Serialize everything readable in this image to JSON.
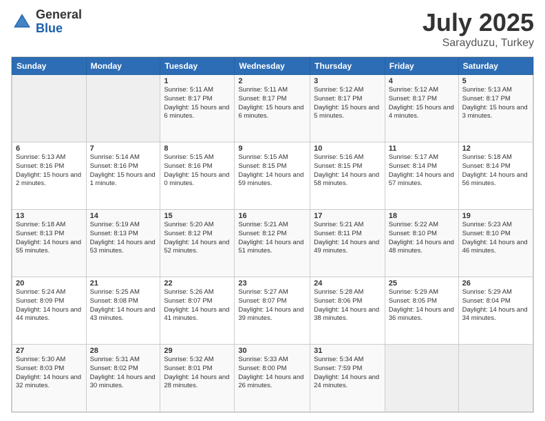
{
  "header": {
    "logo_general": "General",
    "logo_blue": "Blue",
    "main_title": "July 2025",
    "subtitle": "Sarayduzu, Turkey"
  },
  "calendar": {
    "days_of_week": [
      "Sunday",
      "Monday",
      "Tuesday",
      "Wednesday",
      "Thursday",
      "Friday",
      "Saturday"
    ],
    "weeks": [
      [
        {
          "day": "",
          "empty": true
        },
        {
          "day": "",
          "empty": true
        },
        {
          "day": "1",
          "sunrise": "Sunrise: 5:11 AM",
          "sunset": "Sunset: 8:17 PM",
          "daylight": "Daylight: 15 hours and 6 minutes."
        },
        {
          "day": "2",
          "sunrise": "Sunrise: 5:11 AM",
          "sunset": "Sunset: 8:17 PM",
          "daylight": "Daylight: 15 hours and 6 minutes."
        },
        {
          "day": "3",
          "sunrise": "Sunrise: 5:12 AM",
          "sunset": "Sunset: 8:17 PM",
          "daylight": "Daylight: 15 hours and 5 minutes."
        },
        {
          "day": "4",
          "sunrise": "Sunrise: 5:12 AM",
          "sunset": "Sunset: 8:17 PM",
          "daylight": "Daylight: 15 hours and 4 minutes."
        },
        {
          "day": "5",
          "sunrise": "Sunrise: 5:13 AM",
          "sunset": "Sunset: 8:17 PM",
          "daylight": "Daylight: 15 hours and 3 minutes."
        }
      ],
      [
        {
          "day": "6",
          "sunrise": "Sunrise: 5:13 AM",
          "sunset": "Sunset: 8:16 PM",
          "daylight": "Daylight: 15 hours and 2 minutes."
        },
        {
          "day": "7",
          "sunrise": "Sunrise: 5:14 AM",
          "sunset": "Sunset: 8:16 PM",
          "daylight": "Daylight: 15 hours and 1 minute."
        },
        {
          "day": "8",
          "sunrise": "Sunrise: 5:15 AM",
          "sunset": "Sunset: 8:16 PM",
          "daylight": "Daylight: 15 hours and 0 minutes."
        },
        {
          "day": "9",
          "sunrise": "Sunrise: 5:15 AM",
          "sunset": "Sunset: 8:15 PM",
          "daylight": "Daylight: 14 hours and 59 minutes."
        },
        {
          "day": "10",
          "sunrise": "Sunrise: 5:16 AM",
          "sunset": "Sunset: 8:15 PM",
          "daylight": "Daylight: 14 hours and 58 minutes."
        },
        {
          "day": "11",
          "sunrise": "Sunrise: 5:17 AM",
          "sunset": "Sunset: 8:14 PM",
          "daylight": "Daylight: 14 hours and 57 minutes."
        },
        {
          "day": "12",
          "sunrise": "Sunrise: 5:18 AM",
          "sunset": "Sunset: 8:14 PM",
          "daylight": "Daylight: 14 hours and 56 minutes."
        }
      ],
      [
        {
          "day": "13",
          "sunrise": "Sunrise: 5:18 AM",
          "sunset": "Sunset: 8:13 PM",
          "daylight": "Daylight: 14 hours and 55 minutes."
        },
        {
          "day": "14",
          "sunrise": "Sunrise: 5:19 AM",
          "sunset": "Sunset: 8:13 PM",
          "daylight": "Daylight: 14 hours and 53 minutes."
        },
        {
          "day": "15",
          "sunrise": "Sunrise: 5:20 AM",
          "sunset": "Sunset: 8:12 PM",
          "daylight": "Daylight: 14 hours and 52 minutes."
        },
        {
          "day": "16",
          "sunrise": "Sunrise: 5:21 AM",
          "sunset": "Sunset: 8:12 PM",
          "daylight": "Daylight: 14 hours and 51 minutes."
        },
        {
          "day": "17",
          "sunrise": "Sunrise: 5:21 AM",
          "sunset": "Sunset: 8:11 PM",
          "daylight": "Daylight: 14 hours and 49 minutes."
        },
        {
          "day": "18",
          "sunrise": "Sunrise: 5:22 AM",
          "sunset": "Sunset: 8:10 PM",
          "daylight": "Daylight: 14 hours and 48 minutes."
        },
        {
          "day": "19",
          "sunrise": "Sunrise: 5:23 AM",
          "sunset": "Sunset: 8:10 PM",
          "daylight": "Daylight: 14 hours and 46 minutes."
        }
      ],
      [
        {
          "day": "20",
          "sunrise": "Sunrise: 5:24 AM",
          "sunset": "Sunset: 8:09 PM",
          "daylight": "Daylight: 14 hours and 44 minutes."
        },
        {
          "day": "21",
          "sunrise": "Sunrise: 5:25 AM",
          "sunset": "Sunset: 8:08 PM",
          "daylight": "Daylight: 14 hours and 43 minutes."
        },
        {
          "day": "22",
          "sunrise": "Sunrise: 5:26 AM",
          "sunset": "Sunset: 8:07 PM",
          "daylight": "Daylight: 14 hours and 41 minutes."
        },
        {
          "day": "23",
          "sunrise": "Sunrise: 5:27 AM",
          "sunset": "Sunset: 8:07 PM",
          "daylight": "Daylight: 14 hours and 39 minutes."
        },
        {
          "day": "24",
          "sunrise": "Sunrise: 5:28 AM",
          "sunset": "Sunset: 8:06 PM",
          "daylight": "Daylight: 14 hours and 38 minutes."
        },
        {
          "day": "25",
          "sunrise": "Sunrise: 5:29 AM",
          "sunset": "Sunset: 8:05 PM",
          "daylight": "Daylight: 14 hours and 36 minutes."
        },
        {
          "day": "26",
          "sunrise": "Sunrise: 5:29 AM",
          "sunset": "Sunset: 8:04 PM",
          "daylight": "Daylight: 14 hours and 34 minutes."
        }
      ],
      [
        {
          "day": "27",
          "sunrise": "Sunrise: 5:30 AM",
          "sunset": "Sunset: 8:03 PM",
          "daylight": "Daylight: 14 hours and 32 minutes."
        },
        {
          "day": "28",
          "sunrise": "Sunrise: 5:31 AM",
          "sunset": "Sunset: 8:02 PM",
          "daylight": "Daylight: 14 hours and 30 minutes."
        },
        {
          "day": "29",
          "sunrise": "Sunrise: 5:32 AM",
          "sunset": "Sunset: 8:01 PM",
          "daylight": "Daylight: 14 hours and 28 minutes."
        },
        {
          "day": "30",
          "sunrise": "Sunrise: 5:33 AM",
          "sunset": "Sunset: 8:00 PM",
          "daylight": "Daylight: 14 hours and 26 minutes."
        },
        {
          "day": "31",
          "sunrise": "Sunrise: 5:34 AM",
          "sunset": "Sunset: 7:59 PM",
          "daylight": "Daylight: 14 hours and 24 minutes."
        },
        {
          "day": "",
          "empty": true
        },
        {
          "day": "",
          "empty": true
        }
      ]
    ]
  }
}
